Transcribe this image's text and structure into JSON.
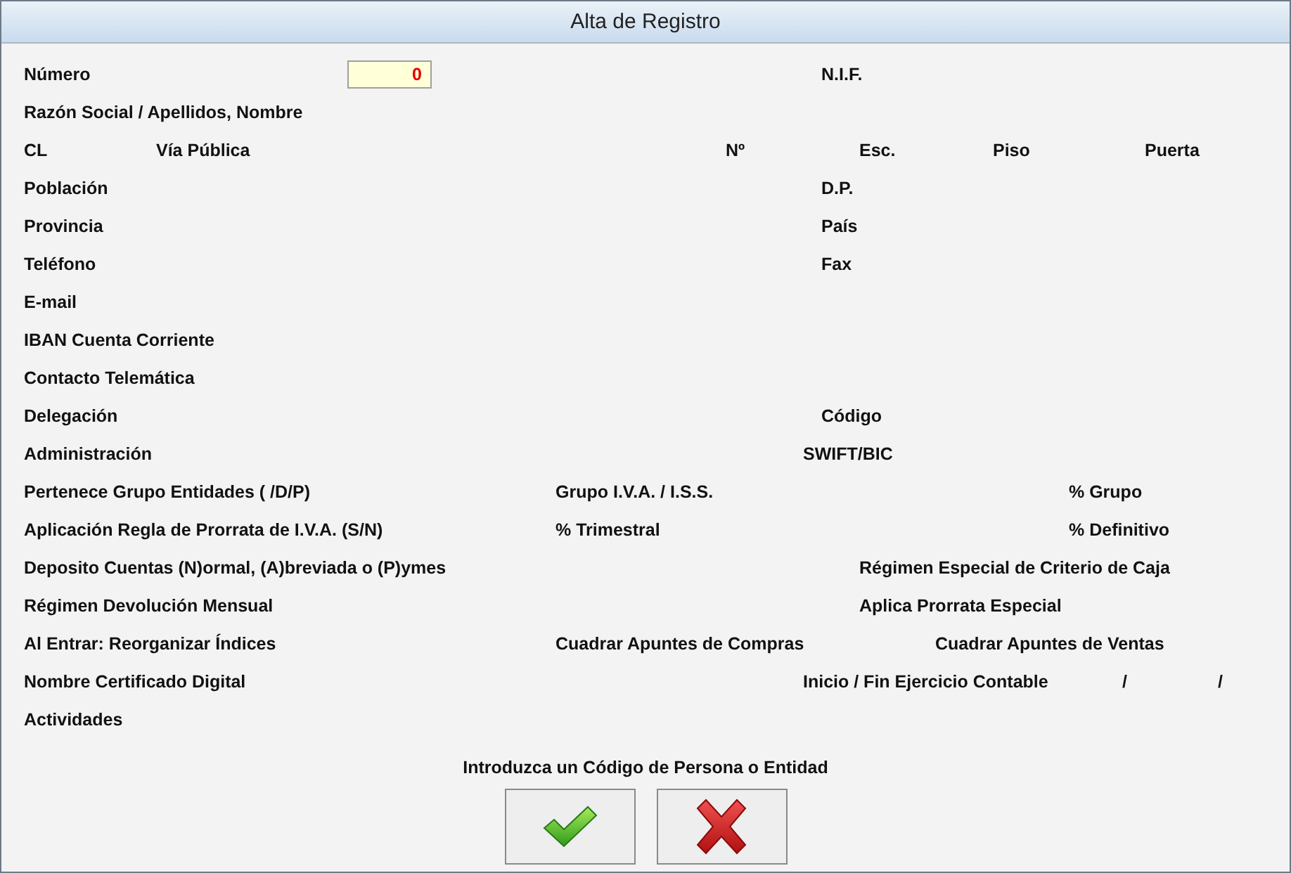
{
  "window": {
    "title": "Alta de Registro"
  },
  "rows": [
    {
      "kind": "numero",
      "items": [
        {
          "kind": "label",
          "text": "Número"
        },
        {
          "kind": "field",
          "value": "0"
        },
        {
          "kind": "label",
          "text": "N.I.F."
        }
      ]
    },
    {
      "kind": "single",
      "items": [
        {
          "kind": "label",
          "text": "Razón Social / Apellidos, Nombre"
        }
      ]
    },
    {
      "kind": "address",
      "items": [
        {
          "kind": "label",
          "text": "CL"
        },
        {
          "kind": "label",
          "text": "Vía Pública"
        },
        {
          "kind": "label",
          "text": "Nº"
        },
        {
          "kind": "label",
          "text": "Esc."
        },
        {
          "kind": "label",
          "text": "Piso"
        },
        {
          "kind": "label",
          "text": "Puerta"
        }
      ]
    },
    {
      "kind": "pair",
      "items": [
        {
          "kind": "label",
          "text": "Población"
        },
        {
          "kind": "label",
          "text": "D.P."
        }
      ]
    },
    {
      "kind": "pair",
      "items": [
        {
          "kind": "label",
          "text": "Provincia"
        },
        {
          "kind": "label",
          "text": "País"
        }
      ]
    },
    {
      "kind": "pair",
      "items": [
        {
          "kind": "label",
          "text": "Teléfono"
        },
        {
          "kind": "label",
          "text": "Fax"
        }
      ]
    },
    {
      "kind": "single",
      "items": [
        {
          "kind": "label",
          "text": "E-mail"
        }
      ]
    },
    {
      "kind": "single",
      "items": [
        {
          "kind": "label",
          "text": "IBAN Cuenta Corriente"
        }
      ]
    },
    {
      "kind": "single",
      "items": [
        {
          "kind": "label",
          "text": "Contacto Telemática"
        }
      ]
    },
    {
      "kind": "pair",
      "items": [
        {
          "kind": "label",
          "text": "Delegación"
        },
        {
          "kind": "label",
          "text": "Código"
        }
      ]
    },
    {
      "kind": "swift",
      "items": [
        {
          "kind": "label",
          "text": "Administración"
        },
        {
          "kind": "label",
          "text": "SWIFT/BIC"
        }
      ]
    },
    {
      "kind": "triple",
      "items": [
        {
          "kind": "label",
          "text": "Pertenece Grupo Entidades ( /D/P)"
        },
        {
          "kind": "label",
          "text": "Grupo I.V.A. / I.S.S."
        },
        {
          "kind": "label",
          "text": "% Grupo"
        }
      ]
    },
    {
      "kind": "triple",
      "items": [
        {
          "kind": "label",
          "text": "Aplicación Regla de Prorrata de I.V.A. (S/N)"
        },
        {
          "kind": "label",
          "text": "% Trimestral"
        },
        {
          "kind": "label",
          "text": "% Definitivo"
        }
      ]
    },
    {
      "kind": "wide",
      "items": [
        {
          "kind": "label",
          "text": "Deposito Cuentas (N)ormal, (A)breviada o (P)ymes"
        },
        {
          "kind": "label",
          "text": "Régimen Especial de Criterio de Caja"
        }
      ]
    },
    {
      "kind": "wide",
      "items": [
        {
          "kind": "label",
          "text": "Régimen Devolución Mensual"
        },
        {
          "kind": "label",
          "text": "Aplica Prorrata Especial"
        }
      ]
    },
    {
      "kind": "cuadrar",
      "items": [
        {
          "kind": "label",
          "text": "Al Entrar: Reorganizar Índices"
        },
        {
          "kind": "label",
          "text": "Cuadrar Apuntes de Compras"
        },
        {
          "kind": "label",
          "text": "Cuadrar Apuntes de Ventas"
        }
      ]
    },
    {
      "kind": "ejercicio",
      "items": [
        {
          "kind": "label",
          "text": "Nombre Certificado Digital"
        },
        {
          "kind": "label",
          "text": "Inicio / Fin Ejercicio Contable"
        },
        {
          "kind": "label",
          "text": "/"
        },
        {
          "kind": "label",
          "text": "/"
        }
      ]
    },
    {
      "kind": "single",
      "items": [
        {
          "kind": "label",
          "text": "Actividades"
        }
      ]
    }
  ],
  "message": "Introduzca un Código de Persona o Entidad",
  "buttons": [
    {
      "kind": "accept"
    },
    {
      "kind": "cancel"
    }
  ]
}
